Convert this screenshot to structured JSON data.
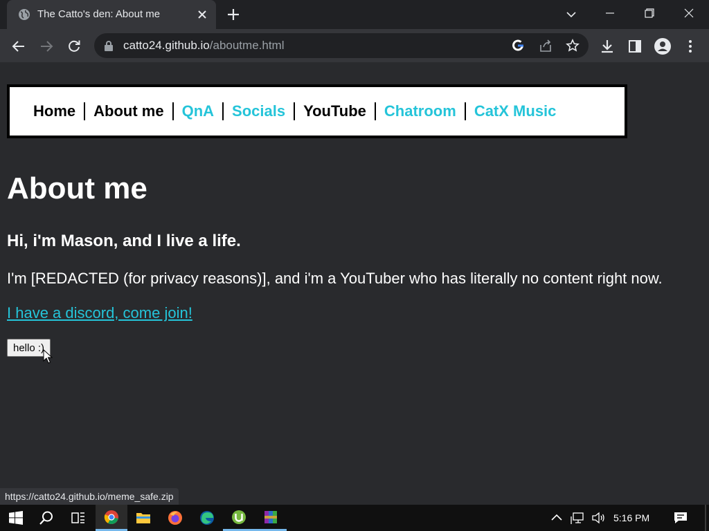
{
  "browser": {
    "tab_title": "The Catto's den: About me",
    "url_host": "catto24.github.io",
    "url_path": "/aboutme.html",
    "status_url": "https://catto24.github.io/meme_safe.zip"
  },
  "nav": {
    "items": [
      {
        "label": "Home",
        "is_link": false
      },
      {
        "label": "About me",
        "is_link": false
      },
      {
        "label": "QnA",
        "is_link": true
      },
      {
        "label": "Socials",
        "is_link": true
      },
      {
        "label": "YouTube",
        "is_link": false
      },
      {
        "label": "Chatroom",
        "is_link": true
      },
      {
        "label": "CatX Music",
        "is_link": true
      }
    ]
  },
  "content": {
    "heading": "About me",
    "subheading": "Hi, i'm Mason, and I live a life.",
    "paragraph": "I'm [REDACTED (for privacy reasons)], and i'm a YouTuber who has literally no content right now.",
    "discord_link": "I have a discord, come join!",
    "button_label": "hello :)"
  },
  "taskbar": {
    "clock": "5:16 PM",
    "apps": [
      "start-icon",
      "search-icon",
      "task-view-icon",
      "chrome-icon",
      "file-explorer-icon",
      "firefox-icon",
      "edge-icon",
      "utorrent-icon",
      "winrar-icon"
    ]
  },
  "colors": {
    "page_bg": "#292a2d",
    "link": "#25c4d9",
    "chrome_dark": "#202124",
    "chrome_toolbar": "#35363a"
  }
}
